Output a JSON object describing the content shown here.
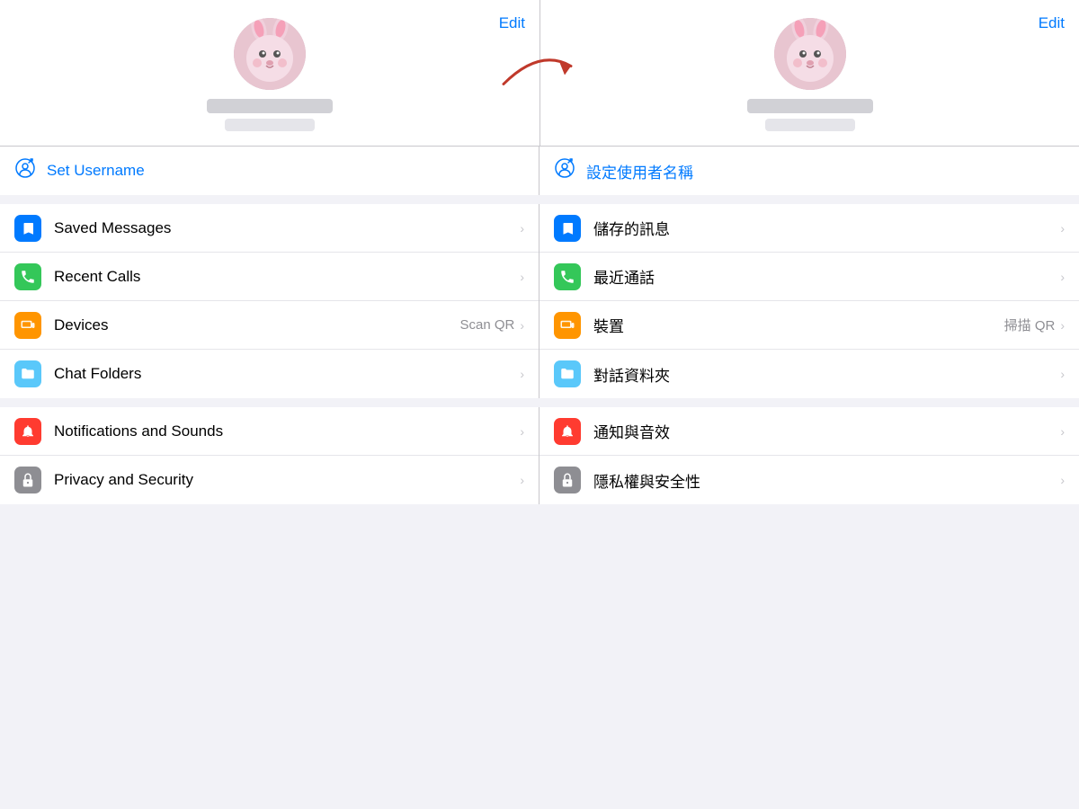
{
  "header": {
    "edit_label": "Edit"
  },
  "left_panel": {
    "username_icon": "👤",
    "username_label": "Set Username",
    "menu_items": [
      {
        "id": "saved-messages",
        "icon": "🔖",
        "icon_class": "icon-blue",
        "label": "Saved Messages",
        "hint": "",
        "chevron": "›"
      },
      {
        "id": "recent-calls",
        "icon": "📞",
        "icon_class": "icon-green",
        "label": "Recent Calls",
        "hint": "",
        "chevron": "›"
      },
      {
        "id": "devices",
        "icon": "💻",
        "icon_class": "icon-orange",
        "label": "Devices",
        "hint": "Scan QR",
        "chevron": "›"
      },
      {
        "id": "chat-folders",
        "icon": "🗂",
        "icon_class": "icon-teal",
        "label": "Chat Folders",
        "hint": "",
        "chevron": "›"
      }
    ],
    "menu_items2": [
      {
        "id": "notifications",
        "icon": "🔔",
        "icon_class": "icon-red",
        "label": "Notifications and Sounds",
        "hint": "",
        "chevron": "›"
      },
      {
        "id": "privacy",
        "icon": "🔒",
        "icon_class": "icon-gray",
        "label": "Privacy and Security",
        "hint": "",
        "chevron": "›"
      }
    ]
  },
  "right_panel": {
    "username_icon": "👤",
    "username_label": "設定使用者名稱",
    "menu_items": [
      {
        "id": "saved-messages-tw",
        "icon": "🔖",
        "icon_class": "icon-blue",
        "label": "儲存的訊息",
        "hint": "",
        "chevron": "›"
      },
      {
        "id": "recent-calls-tw",
        "icon": "📞",
        "icon_class": "icon-green",
        "label": "最近通話",
        "hint": "",
        "chevron": "›"
      },
      {
        "id": "devices-tw",
        "icon": "💻",
        "icon_class": "icon-orange",
        "label": "裝置",
        "hint": "掃描 QR",
        "chevron": "›"
      },
      {
        "id": "chat-folders-tw",
        "icon": "🗂",
        "icon_class": "icon-teal",
        "label": "對話資料夾",
        "hint": "",
        "chevron": "›"
      }
    ],
    "menu_items2": [
      {
        "id": "notifications-tw",
        "icon": "🔔",
        "icon_class": "icon-red",
        "label": "通知與音效",
        "hint": "",
        "chevron": "›"
      },
      {
        "id": "privacy-tw",
        "icon": "🔒",
        "icon_class": "icon-gray",
        "label": "隱私權與安全性",
        "hint": "",
        "chevron": "›"
      }
    ]
  }
}
